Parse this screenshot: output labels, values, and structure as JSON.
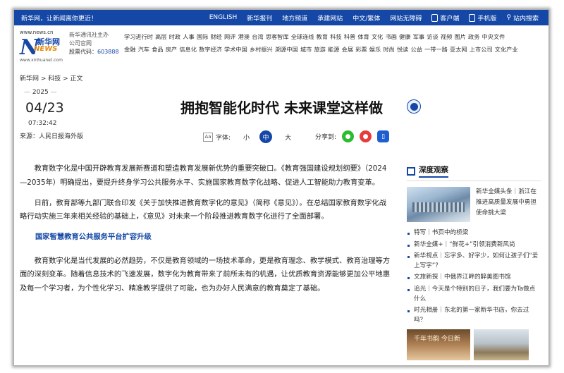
{
  "topbar": {
    "slogan": "新华网，让新闻离你更近！",
    "nav": [
      "ENGLISH",
      "新华报刊",
      "地方频道",
      "承建网站",
      "中文/繁体",
      "网站无障碍"
    ],
    "client_label": "客户端",
    "mobile_label": "手机版",
    "search_label": "站内搜索"
  },
  "header": {
    "logo_url": "www.news.cn",
    "logo_cn": "新华网",
    "logo_news": "NEWS",
    "logo_sub": "www.xinhuanet.com",
    "agency_line1": "新华通讯社主办",
    "agency_line2": "公司官网",
    "stock_label": "股票代码：",
    "stock_code": "603888",
    "channels_row1": [
      "学习进行时",
      "高层",
      "时政",
      "人事",
      "国际",
      "财经",
      "网评",
      "港澳",
      "台湾",
      "思客智库",
      "全球连线",
      "教育",
      "科技",
      "科普",
      "体育",
      "文化",
      "书画",
      "健康",
      "军事",
      "访谈",
      "视频",
      "图片",
      "政务",
      "中央文件"
    ],
    "channels_row2": [
      "金融",
      "汽车",
      "食品",
      "房产",
      "信息化",
      "数字经济",
      "学术中国",
      "乡村振兴",
      "溯源中国",
      "城市",
      "旅游",
      "能源",
      "会展",
      "彩票",
      "娱乐",
      "时尚",
      "悦读",
      "公益",
      "一带一路",
      "亚太网",
      "上市公司",
      "文化产业"
    ]
  },
  "breadcrumb": "新华网 > 科技 > 正文",
  "date": {
    "year": "2025",
    "month_day": "04/23",
    "time": "07:32:42",
    "source": "来源：人民日报海外版"
  },
  "article": {
    "title": "拥抱智能化时代 未来课堂这样做",
    "font_label": "字体:",
    "font_small": "小",
    "font_medium": "中",
    "font_large": "大",
    "share_label": "分享到:",
    "paragraphs": [
      "教育数字化是中国开辟教育发展新赛道和塑造教育发展新优势的重要突破口。《教育强国建设规划纲要》（2024—2035年）明确提出，要提升终身学习公共服务水平、实施国家教育数字化战略、促进人工智能助力教育变革。",
      "日前，教育部等九部门联合印发《关于加快推进教育数字化的意见》（简称《意见》）。在总结国家教育数字化战略行动实施三年来相关经验的基础上，《意见》对未来一个阶段推进教育数字化进行了全面部署。"
    ],
    "subheading": "国家智慧教育公共服务平台扩容升级",
    "paragraph3": "教育数字化是当代发展的必然趋势，不仅是教育领域的一场技术革命，更是教育理念、教学模式、教育治理等方面的深刻变革。随着信息技术的飞速发展，数字化为教育带来了前所未有的机遇，让优质教育资源能够更加公平地惠及每一个学习者，为个性化学习、精准教学提供了可能，也为办好人民满意的教育奠定了基础。"
  },
  "sidebar": {
    "heading": "深度观察",
    "feature_text": "新华全媒头条｜浙江在推进高质量发展中勇担使命挑大梁",
    "items": [
      "特写｜书页中的桥梁",
      "新华全媒+｜“鲜花+”引领消费新风尚",
      "新华视点｜忘字多、好字少，如何让孩子们“爱上写字”？",
      "文旅新探｜中俄界江畔的醉美图书馆",
      "追光｜今天是个特别的日子，我们要为Ta做点什么",
      "时光相册｜东北的第一家新华书店，你去过吗？"
    ],
    "thumb1_text": "千年书韵 今日新"
  },
  "colors": {
    "brand_blue": "#1548a6",
    "accent_orange": "#e48b10"
  }
}
